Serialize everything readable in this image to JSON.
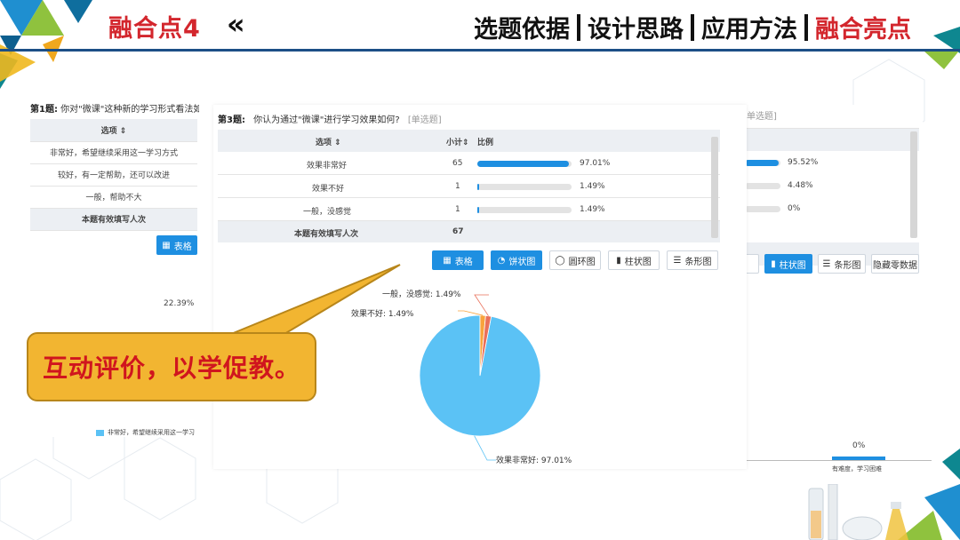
{
  "header": {
    "title": "融合点4",
    "arrow": "«",
    "tabs": [
      "选题依据",
      "设计思路",
      "应用方法",
      "融合亮点"
    ],
    "active_index": 3
  },
  "left_panel": {
    "q_no": "第1题:",
    "q_text": "你对\"微课\"这种新的学习形式看法如何",
    "col_option": "选项 ⇕",
    "rows": [
      "非常好，希望继续采用这一学习方式",
      "较好，有一定帮助，还可以改进",
      "一般，帮助不大"
    ],
    "total_label": "本题有效填写人次",
    "table_btn": "表格",
    "pie_label": "22.39%",
    "legend": "非常好，希望继续采用这一学习"
  },
  "center_panel": {
    "q_no": "第3题:",
    "q_text": "你认为通过\"微课\"进行学习效果如何?",
    "q_type": "[单选题]",
    "col_option": "选项 ⇕",
    "col_count": "小计⇕",
    "col_ratio": "比例",
    "rows": [
      {
        "label": "效果非常好",
        "count": "65",
        "pct": "97.01%",
        "fill": 0.9701
      },
      {
        "label": "效果不好",
        "count": "1",
        "pct": "1.49%",
        "fill": 0.0149
      },
      {
        "label": "一般，没感觉",
        "count": "1",
        "pct": "1.49%",
        "fill": 0.0149
      }
    ],
    "total_label": "本题有效填写人次",
    "total_value": "67",
    "buttons": [
      "表格",
      "饼状图",
      "圆环图",
      "柱状图",
      "条形图"
    ]
  },
  "chart_data": {
    "type": "pie",
    "categories": [
      "效果非常好",
      "效果不好",
      "一般，没感觉"
    ],
    "values": [
      97.01,
      1.49,
      1.49
    ],
    "labels": [
      "效果非常好: 97.01%",
      "效果不好: 1.49%",
      "一般，没感觉: 1.49%"
    ],
    "colors": [
      "#5bc2f5",
      "#f8a33c",
      "#e9705a"
    ]
  },
  "right_panel": {
    "q_type": "单选题]",
    "rows": [
      {
        "pct": "95.52%",
        "fill": 0.9552
      },
      {
        "pct": "4.48%",
        "fill": 0.0448
      },
      {
        "pct": "0%",
        "fill": 0
      }
    ],
    "buttons": [
      "柱状图",
      "条形图",
      "隐藏零数据"
    ],
    "bar_value": "0%",
    "bar_category": "有难度，学习困难"
  },
  "callout": {
    "text": "互动评价，以学促教。"
  }
}
